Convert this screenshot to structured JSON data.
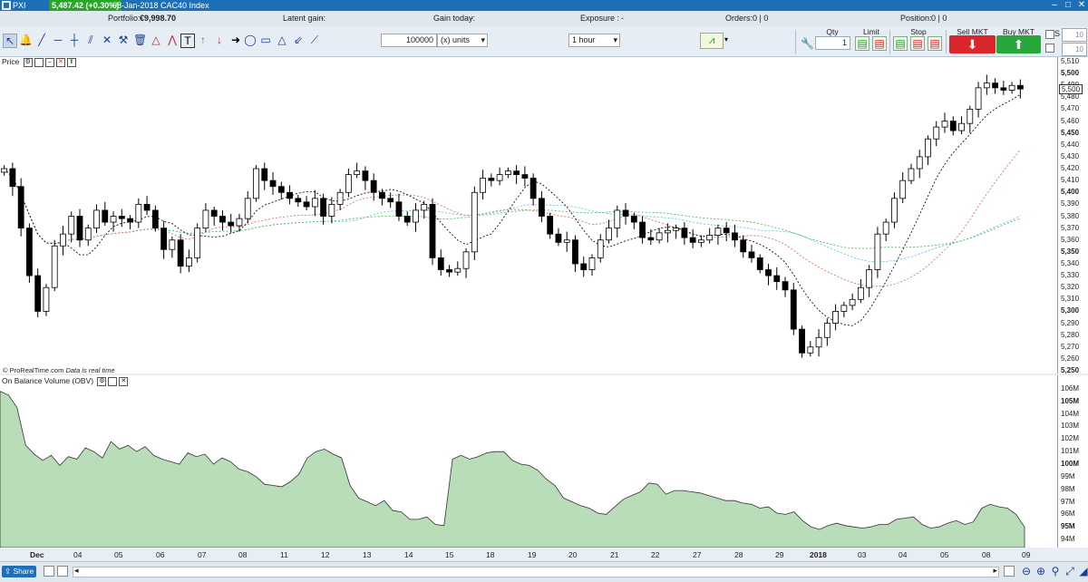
{
  "titlebar": {
    "last_price": "5,487.42 (+0.30%)",
    "product": "PXI",
    "title": "08-Jan-2018 CAC40 Index"
  },
  "portfolio": {
    "portfolio_label": "Portfolio:",
    "portfolio_value": "€9,998.70",
    "latent_label": "Latent gain:",
    "latent_value": "-",
    "gain_today_label": "Gain today:",
    "gain_today_value": "-",
    "exposure_label": "Exposure :",
    "exposure_value": "-",
    "orders_label": "Orders:",
    "orders_value": "0 | 0",
    "position_label": "Position:",
    "position_value": "0 | 0"
  },
  "toolbar": {
    "quantity_value": "100000",
    "units_select": "(x) units",
    "timeframe_select": "1 hour",
    "qty_label": "Qty",
    "qty_value": "1",
    "limit_label": "Limit",
    "stop_label": "Stop",
    "sell_label": "Sell MKT",
    "buy_label": "Buy MKT",
    "s_label": "S",
    "s_value": "10",
    "p_value": "10"
  },
  "panels": {
    "price_title": "Price",
    "obv_title": "On Balance Volume (OBV)",
    "watermark": "© ProRealTime.com",
    "realtime": "Data is real time"
  },
  "bottom": {
    "share": "Share"
  },
  "colors": {
    "candle_up": "#ffffff",
    "candle_down": "#000000",
    "ma_black": "#111111",
    "ma_red": "#e07070",
    "ma_green": "#55c060",
    "ma_cyan": "#5fc8d8",
    "obv_fill": "#b8ddb8",
    "sell": "#d8262a",
    "buy": "#28a83a"
  },
  "chart_data": [
    {
      "type": "candlestick",
      "title": "CAC40 Index",
      "timeframe": "1 hour",
      "x_ticks": [
        "Dec",
        "04",
        "05",
        "06",
        "07",
        "08",
        "11",
        "12",
        "13",
        "14",
        "15",
        "18",
        "19",
        "20",
        "21",
        "22",
        "27",
        "28",
        "29",
        "2018",
        "03",
        "04",
        "05",
        "08",
        "09"
      ],
      "y_ticks": [
        "5,510",
        "5,500",
        "5,490",
        "5,480",
        "5,470",
        "5,460",
        "5,450",
        "5,440",
        "5,430",
        "5,420",
        "5,410",
        "5,400",
        "5,390",
        "5,380",
        "5,370",
        "5,360",
        "5,350",
        "5,340",
        "5,330",
        "5,320",
        "5,310",
        "5,300",
        "5,290",
        "5,280",
        "5,270",
        "5,260",
        "5,250"
      ],
      "ylim": [
        5250,
        5510
      ],
      "current_price": 5487.42,
      "close_series": [
        5420,
        5405,
        5370,
        5330,
        5300,
        5320,
        5355,
        5365,
        5380,
        5360,
        5370,
        5385,
        5375,
        5380,
        5378,
        5375,
        5390,
        5385,
        5370,
        5352,
        5360,
        5338,
        5345,
        5370,
        5385,
        5380,
        5375,
        5372,
        5378,
        5395,
        5420,
        5410,
        5405,
        5400,
        5395,
        5392,
        5388,
        5395,
        5380,
        5390,
        5400,
        5415,
        5418,
        5410,
        5400,
        5395,
        5392,
        5380,
        5375,
        5385,
        5390,
        5345,
        5335,
        5333,
        5336,
        5350,
        5400,
        5412,
        5410,
        5415,
        5418,
        5415,
        5412,
        5395,
        5380,
        5365,
        5358,
        5360,
        5340,
        5335,
        5345,
        5360,
        5370,
        5385,
        5380,
        5375,
        5362,
        5360,
        5366,
        5368,
        5370,
        5362,
        5358,
        5360,
        5364,
        5370,
        5366,
        5360,
        5350,
        5345,
        5335,
        5330,
        5325,
        5318,
        5285,
        5265,
        5270,
        5278,
        5290,
        5300,
        5305,
        5310,
        5320,
        5335,
        5365,
        5375,
        5395,
        5410,
        5420,
        5430,
        5445,
        5455,
        5460,
        5452,
        5458,
        5470,
        5488,
        5492,
        5488,
        5486,
        5490,
        5487
      ]
    },
    {
      "type": "area",
      "title": "On Balance Volume (OBV)",
      "y_ticks": [
        "106M",
        "105M",
        "104M",
        "103M",
        "102M",
        "101M",
        "100M",
        "99M",
        "98M",
        "97M",
        "96M",
        "95M",
        "94M"
      ],
      "ylim": [
        93.5,
        106.5
      ],
      "values": [
        105.8,
        105.5,
        104.5,
        101.5,
        100.8,
        100.3,
        100.7,
        99.9,
        100.6,
        100.4,
        101.3,
        101.0,
        100.5,
        101.8,
        101.2,
        101.5,
        101.0,
        101.4,
        100.7,
        100.4,
        100.2,
        100.0,
        100.9,
        100.6,
        100.8,
        100.0,
        100.5,
        100.2,
        99.6,
        99.4,
        99.0,
        98.4,
        98.3,
        98.2,
        98.6,
        99.2,
        100.5,
        101.0,
        101.2,
        100.8,
        100.5,
        98.3,
        97.3,
        97.0,
        96.7,
        97.1,
        96.3,
        96.2,
        95.6,
        95.6,
        95.8,
        95.2,
        95.1,
        100.4,
        100.7,
        100.4,
        100.6,
        100.9,
        101.0,
        101.0,
        100.3,
        100.0,
        99.9,
        99.5,
        98.8,
        98.3,
        97.3,
        97.0,
        96.7,
        96.5,
        96.1,
        96.0,
        96.6,
        97.2,
        97.5,
        97.8,
        98.5,
        98.4,
        97.6,
        97.9,
        97.9,
        97.8,
        97.7,
        97.5,
        97.3,
        97.1,
        97.1,
        96.9,
        96.8,
        96.5,
        96.6,
        96.1,
        96.0,
        96.2,
        95.5,
        95.0,
        94.8,
        95.1,
        95.3,
        95.1,
        95.0,
        94.9,
        95.0,
        95.2,
        95.2,
        95.6,
        95.7,
        95.8,
        95.2,
        94.9,
        95.0,
        95.3,
        95.5,
        95.2,
        95.4,
        96.5,
        96.8,
        96.6,
        96.5,
        96.0,
        95.0
      ]
    }
  ]
}
